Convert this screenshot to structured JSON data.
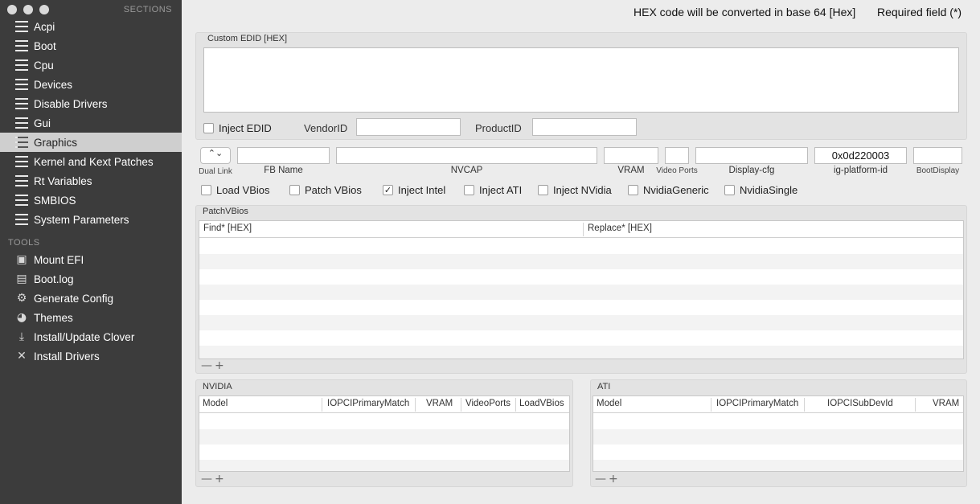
{
  "sidebar": {
    "sections_header": "SECTIONS",
    "tools_header": "TOOLS",
    "sections": [
      {
        "label": "Acpi"
      },
      {
        "label": "Boot"
      },
      {
        "label": "Cpu"
      },
      {
        "label": "Devices"
      },
      {
        "label": "Disable Drivers"
      },
      {
        "label": "Gui"
      },
      {
        "label": "Graphics",
        "selected": true
      },
      {
        "label": "Kernel and Kext Patches"
      },
      {
        "label": "Rt Variables"
      },
      {
        "label": "SMBIOS"
      },
      {
        "label": "System Parameters"
      }
    ],
    "tools": [
      {
        "label": "Mount EFI",
        "icon": "disk-icon"
      },
      {
        "label": "Boot.log",
        "icon": "log-icon"
      },
      {
        "label": "Generate Config",
        "icon": "gears-icon"
      },
      {
        "label": "Themes",
        "icon": "palette-icon"
      },
      {
        "label": "Install/Update Clover",
        "icon": "download-icon"
      },
      {
        "label": "Install Drivers",
        "icon": "tools-icon"
      }
    ]
  },
  "header": {
    "hex_note": "HEX code will be converted in base 64 [Hex]",
    "required_note": "Required field (*)"
  },
  "edid": {
    "title": "Custom EDID [HEX]",
    "value": "",
    "inject_label": "Inject EDID",
    "inject_checked": false,
    "vendor_label": "VendorID",
    "vendor_value": "",
    "product_label": "ProductID",
    "product_value": ""
  },
  "graphics_fields": {
    "dual_link": "Dual Link",
    "fb_name": "FB Name",
    "nvcap": "NVCAP",
    "vram": "VRAM",
    "video_ports": "Video Ports",
    "display_cfg": "Display-cfg",
    "ig_platform_id": "ig-platform-id",
    "ig_platform_id_value": "0x0d220003",
    "boot_display": "BootDisplay"
  },
  "checkboxes": [
    {
      "label": "Load VBios",
      "checked": false
    },
    {
      "label": "Patch VBios",
      "checked": false
    },
    {
      "label": "Inject Intel",
      "checked": true
    },
    {
      "label": "Inject ATI",
      "checked": false
    },
    {
      "label": "Inject NVidia",
      "checked": false
    },
    {
      "label": "NvidiaGeneric",
      "checked": false
    },
    {
      "label": "NvidiaSingle",
      "checked": false
    }
  ],
  "patch_vbios": {
    "title": "PatchVBios",
    "columns": [
      "Find* [HEX]",
      "Replace* [HEX]"
    ],
    "rows": []
  },
  "nvidia": {
    "title": "NVIDIA",
    "columns": [
      "Model",
      "IOPCIPrimaryMatch",
      "VRAM",
      "VideoPorts",
      "LoadVBios"
    ],
    "rows": []
  },
  "ati": {
    "title": "ATI",
    "columns": [
      "Model",
      "IOPCIPrimaryMatch",
      "IOPCISubDevId",
      "VRAM"
    ],
    "rows": []
  },
  "controls": {
    "remove": "—",
    "add": "+",
    "check_mark": "✓",
    "stepper": "⌃⌄"
  }
}
